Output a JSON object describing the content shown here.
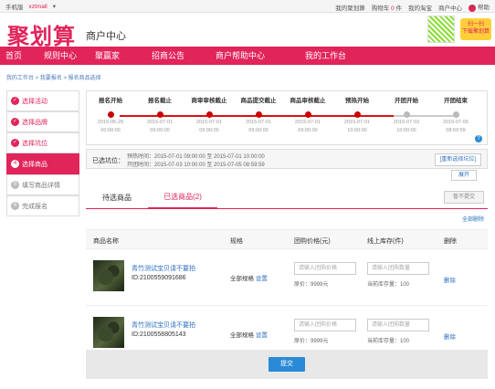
{
  "topbar": {
    "left": {
      "phone": "手机版",
      "user": "xztmall",
      "arrow": "▾"
    },
    "right": {
      "my_juhuasuan": "我的聚划算",
      "cart_label": "购物车",
      "cart_count": "0",
      "cart_unit": "件",
      "my_taobao": "我的淘宝",
      "merchant_center": "商户中心",
      "help": "帮助"
    }
  },
  "brand": {
    "logo": "聚划算",
    "subtitle": "商户中心",
    "qr_tag": "扫一扫\n下载聚划算"
  },
  "nav": [
    "首页",
    "规则中心",
    "聚赢家",
    "招商公告",
    "商户帮助中心",
    "我的工作台"
  ],
  "breadcrumb": "我的工作台 > 我要报名 > 报名商品选择",
  "steps": [
    {
      "label": "选择活动",
      "state": "done"
    },
    {
      "label": "选择品牌",
      "state": "done"
    },
    {
      "label": "选择坑位",
      "state": "done"
    },
    {
      "label": "选择商品",
      "state": "active",
      "num": "4"
    },
    {
      "label": "填写商品详情",
      "state": "todo",
      "num": "5"
    },
    {
      "label": "完成报名",
      "state": "todo",
      "num": "6"
    }
  ],
  "timeline": [
    {
      "title": "报名开始",
      "date": "2015-06-29",
      "time": "00:00:00",
      "done": true
    },
    {
      "title": "报名截止",
      "date": "2015-07-01",
      "time": "09:00:00",
      "done": true
    },
    {
      "title": "商审审核截止",
      "date": "2015-07-01",
      "time": "09:00:00",
      "done": true
    },
    {
      "title": "商品提交截止",
      "date": "2015-07-01",
      "time": "09:00:00",
      "done": true
    },
    {
      "title": "商品审核截止",
      "date": "2015-07-01",
      "time": "09:00:00",
      "done": true
    },
    {
      "title": "预热开始",
      "date": "2015-07-01",
      "time": "10:00:00",
      "done": true
    },
    {
      "title": "开团开始",
      "date": "2015-07-03",
      "time": "10:00:00",
      "done": false
    },
    {
      "title": "开团结束",
      "date": "2015-07-05",
      "time": "08:59:59",
      "done": false
    }
  ],
  "shop": {
    "label": "已选坑位：",
    "preheat": "预热时间：2015-07-01 09:00:00 至 2015-07-01 10:00:00",
    "open": "开团时间：2015-07-03 10:00:00 至 2015-07-05 08:59:59",
    "reselect": "[重新选择坑位]",
    "unfold": "展开"
  },
  "tabs": {
    "pending": "待选商品",
    "selected": "已选商品(2)",
    "no_submit": "暂不提交",
    "delete_all": "全部删除"
  },
  "table": {
    "headers": [
      "商品名称",
      "规格",
      "团购价格(元)",
      "线上库存(件)",
      "删除"
    ],
    "rows": [
      {
        "name": "青竹测试宝贝请不要拍",
        "id": "ID:2100559091686",
        "spec": "全部规格",
        "spec_link": "设置",
        "price_placeholder": "请输入团购价格",
        "orig_price": "原价：9999元",
        "stock_placeholder": "请输入团购数量",
        "stock": "当前库存量：100",
        "delete": "删除"
      },
      {
        "name": "青竹测试宝贝请不要拍",
        "id": "ID:2100558805143",
        "spec": "全部规格",
        "spec_link": "设置",
        "price_placeholder": "请输入团购价格",
        "orig_price": "原价：9999元",
        "stock_placeholder": "请输入团购数量",
        "stock": "当前库存量：100",
        "delete": "删除"
      }
    ]
  },
  "submit": "提交"
}
